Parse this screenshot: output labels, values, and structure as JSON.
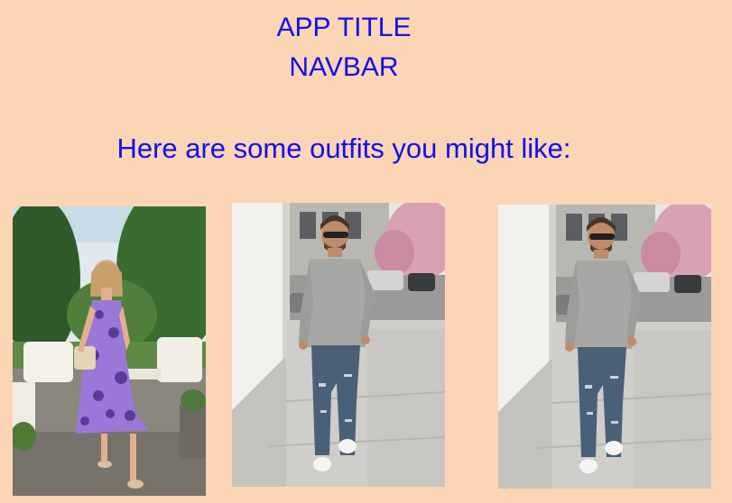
{
  "header": {
    "app_title": "APP TITLE",
    "navbar": "NAVBAR"
  },
  "main": {
    "heading": "Here are some outfits you might like:",
    "outfits": [
      {
        "subject": "woman-purple-floral-dress"
      },
      {
        "subject": "man-gray-tee-ripped-jeans"
      },
      {
        "subject": "man-gray-tee-ripped-jeans"
      }
    ]
  },
  "colors": {
    "background": "#fcd5b4",
    "text": "#1010ee"
  }
}
